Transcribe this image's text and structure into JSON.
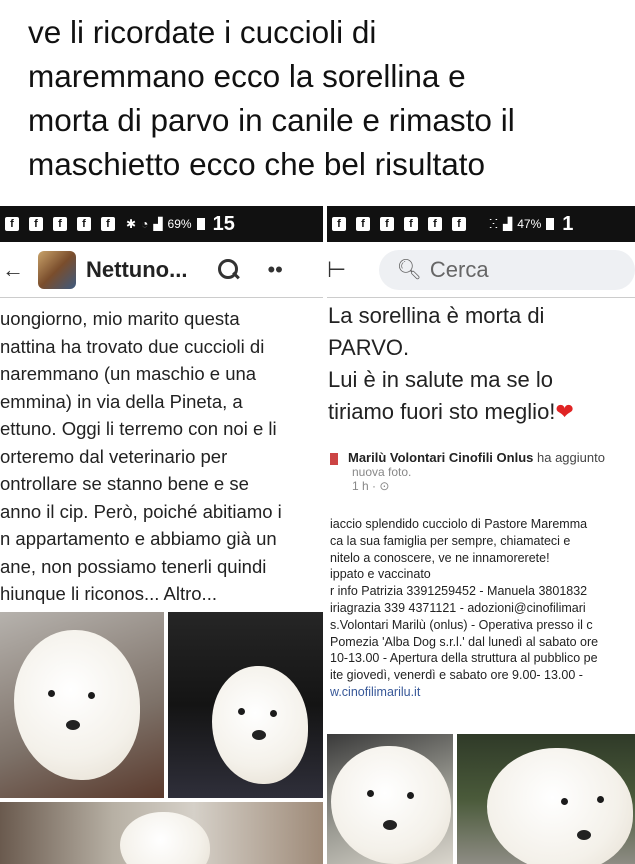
{
  "caption": "ve li ricordate i cuccioli di\nmaremmano ecco la sorellina e\nmorta di parvo in canile e rimasto il\nmaschietto ecco che bel risultato",
  "left_screen": {
    "status": {
      "battery": "69%",
      "time": "15"
    },
    "appbar": {
      "page_name": "Nettuno..."
    },
    "post_text": "uongiorno, mio marito questa\nnattina ha trovato due cuccioli di\nnaremmano (un maschio e una\nemmina) in via della Pineta, a\nettuno. Oggi li terremo con noi e li\norteremo dal veterinario per\nontrollare se stanno bene e se\nanno il cip. Però, poiché abitiamo i\nn appartamento e abbiamo già un\nane, non possiamo tenerli quindi\nhiunque li riconos... Altro..."
  },
  "right_screen": {
    "status": {
      "battery": "47%",
      "time": "1"
    },
    "search": {
      "placeholder": "Cerca"
    },
    "post_text": "La sorellina è morta di\nPARVO.\nLui è in salute ma se lo\ntiriamo fuori sto meglio!",
    "heart": "❤",
    "shared": {
      "author": "Marilù Volontari Cinofili Onlus",
      "action": "ha aggiunto",
      "action2": "nuova foto.",
      "meta": "1 h · ⊙",
      "body": "iaccio splendido cucciolo di Pastore Maremma\nca la sua famiglia per sempre, chiamateci e\nnitelo a conoscere, ve ne innamorerete!\nippato e vaccinato\nr info Patrizia 3391259452 - Manuela 3801832\niriagrazia 339 4371121 - adozioni@cinofilimari\ns.Volontari Marilù (onlus) - Operativa presso il c\nPomezia 'Alba Dog s.r.l.' dal lunedì al sabato ore\n10-13.00 - Apertura della struttura al pubblico pe\nite giovedì, venerdì e sabato ore 9.00- 13.00 -",
      "link": "w.cinofilimarilu.it"
    }
  }
}
